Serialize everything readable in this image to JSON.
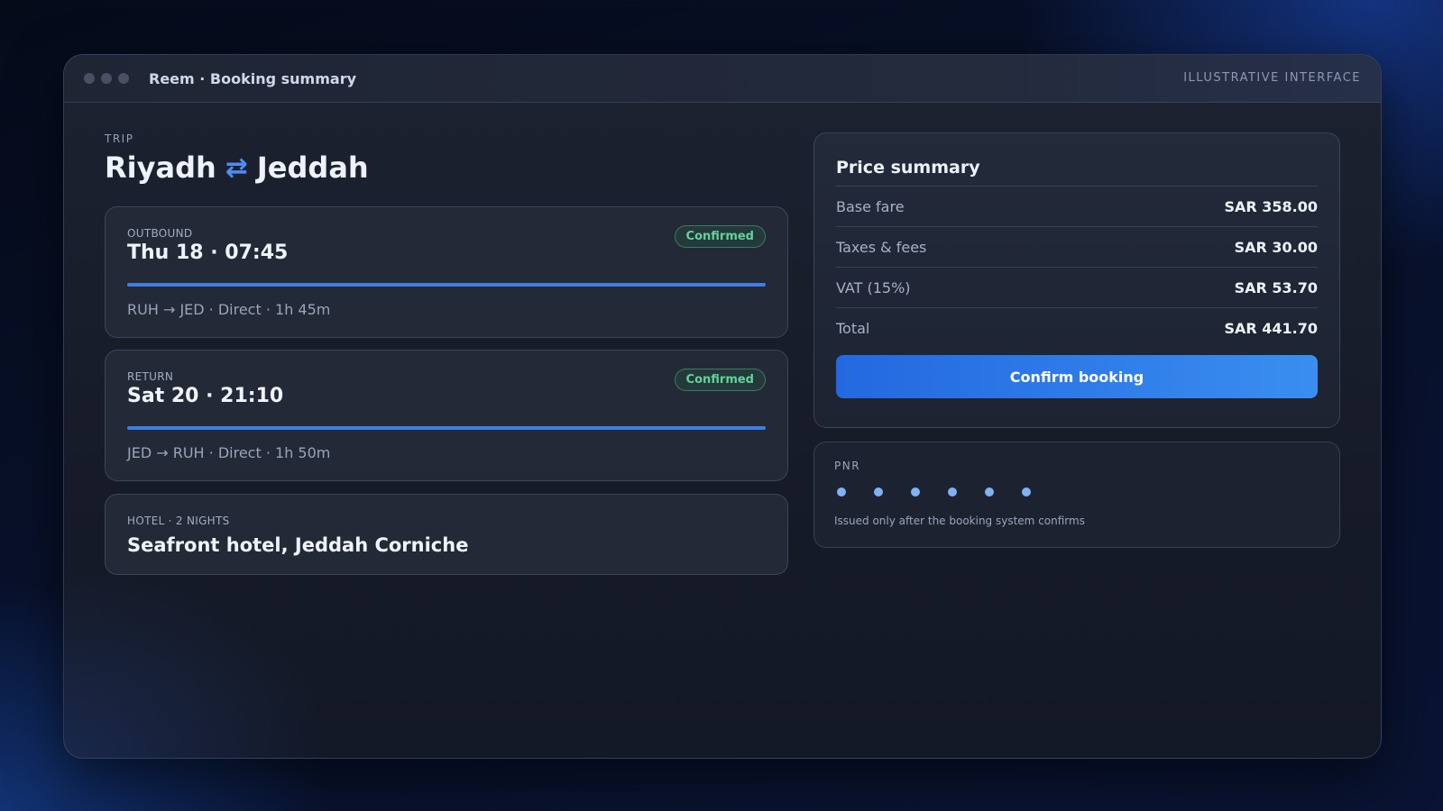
{
  "window": {
    "title": "Reem · Booking summary",
    "tag": "ILLUSTRATIVE INTERFACE"
  },
  "trip": {
    "label": "TRIP",
    "origin": "Riyadh",
    "swap_icon": "⇄",
    "destination": "Jeddah"
  },
  "flights": [
    {
      "kicker": "OUTBOUND",
      "when": "Thu 18 · 07:45",
      "status": "Confirmed",
      "route": "RUH → JED · Direct · 1h 45m",
      "progress_percent": 100
    },
    {
      "kicker": "RETURN",
      "when": "Sat 20 · 21:10",
      "status": "Confirmed",
      "route": "JED → RUH · Direct · 1h 50m",
      "progress_percent": 100
    }
  ],
  "hotel": {
    "kicker": "HOTEL · 2 NIGHTS",
    "name": "Seafront hotel, Jeddah Corniche"
  },
  "price": {
    "title": "Price summary",
    "rows": [
      {
        "label": "Base fare",
        "value": "SAR 358.00"
      },
      {
        "label": "Taxes & fees",
        "value": "SAR 30.00"
      },
      {
        "label": "VAT (15%)",
        "value": "SAR 53.70"
      },
      {
        "label": "Total",
        "value": "SAR 441.70"
      }
    ],
    "confirm_label": "Confirm booking"
  },
  "pnr": {
    "label": "PNR",
    "masked_characters": 6,
    "note": "Issued only after the booking system confirms"
  },
  "colors": {
    "accent": "#3d7ee6",
    "confirmed": "#63d39a",
    "background": "#0a1128"
  }
}
